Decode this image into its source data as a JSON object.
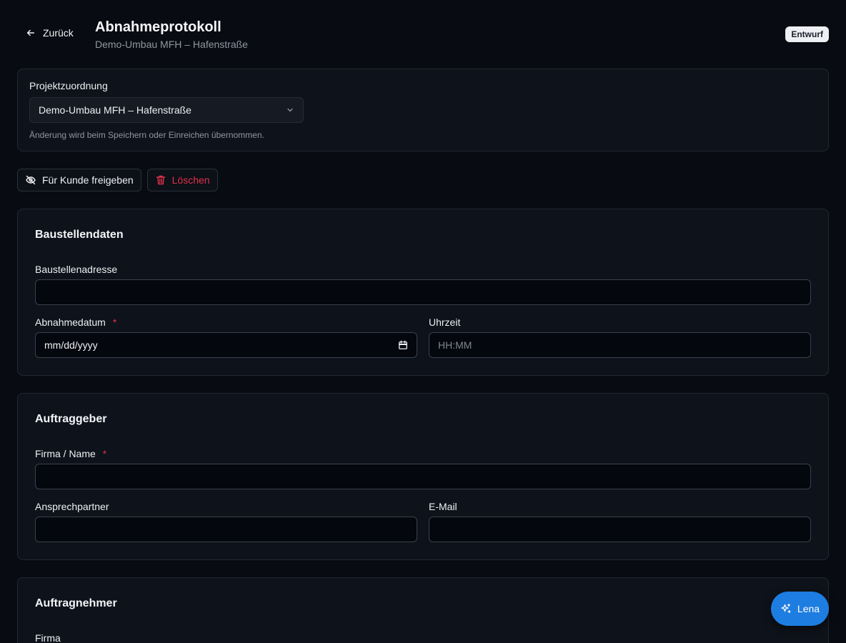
{
  "header": {
    "back_label": "Zurück",
    "title": "Abnahmeprotokoll",
    "subtitle": "Demo-Umbau MFH – Hafenstraße",
    "status": "Entwurf"
  },
  "project": {
    "label": "Projektzuordnung",
    "selected": "Demo-Umbau MFH – Hafenstraße",
    "hint": "Änderung wird beim Speichern oder Einreichen übernommen."
  },
  "actions": {
    "share_label": "Für Kunde freigeben",
    "delete_label": "Löschen"
  },
  "site": {
    "title": "Baustellendaten",
    "address_label": "Baustellenadresse",
    "address_value": "",
    "date_label": "Abnahmedatum",
    "date_required": "*",
    "date_placeholder": "mm/dd/yyyy",
    "time_label": "Uhrzeit",
    "time_placeholder": "HH:MM"
  },
  "client": {
    "title": "Auftraggeber",
    "company_label": "Firma / Name",
    "company_required": "*",
    "contact_label": "Ansprechpartner",
    "email_label": "E-Mail"
  },
  "contractor": {
    "title": "Auftragnehmer",
    "company_label": "Firma"
  },
  "assistant": {
    "label": "Lena"
  },
  "colors": {
    "background": "#080b11",
    "card": "#0e121a",
    "accent": "#1e7de0",
    "danger": "#e0314a"
  }
}
